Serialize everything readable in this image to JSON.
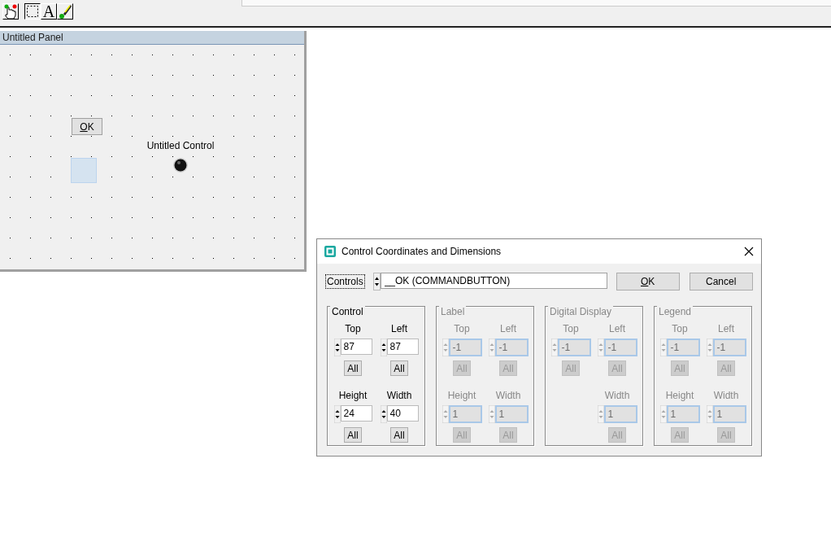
{
  "toolbar": {
    "tools": [
      {
        "kind": "hand",
        "selected": false
      },
      {
        "kind": "select",
        "selected": true
      },
      {
        "kind": "text",
        "glyph": "A",
        "selected": false
      },
      {
        "kind": "brush",
        "selected": false
      }
    ]
  },
  "panel": {
    "title": "Untitled Panel",
    "button": {
      "label": "OK",
      "underline_first": true
    },
    "control_label": "Untitled Control"
  },
  "dialog": {
    "title": "Control Coordinates and Dimensions",
    "controls_label": "Controls",
    "controls_value": "__OK (COMMANDBUTTON)",
    "buttons": [
      {
        "label": "OK",
        "underline_first": true
      },
      {
        "label": "Cancel",
        "underline_first": false
      }
    ],
    "groups": [
      {
        "title": "Control",
        "disabled": false,
        "fields": [
          {
            "kind": "spin",
            "label": "Top",
            "value": "87",
            "button": "All"
          },
          {
            "kind": "spin",
            "label": "Left",
            "value": "87",
            "button": "All"
          },
          {
            "kind": "spin",
            "label": "Height",
            "value": "24",
            "button": "All"
          },
          {
            "kind": "spin",
            "label": "Width",
            "value": "40",
            "button": "All"
          }
        ]
      },
      {
        "title": "Label",
        "disabled": true,
        "fields": [
          {
            "kind": "spin",
            "label": "Top",
            "value": "-1",
            "button": "All"
          },
          {
            "kind": "spin",
            "label": "Left",
            "value": "-1",
            "button": "All"
          },
          {
            "kind": "spin",
            "label": "Height",
            "value": "1",
            "button": "All"
          },
          {
            "kind": "spin",
            "label": "Width",
            "value": "1",
            "button": "All"
          }
        ]
      },
      {
        "title": "Digital Display",
        "disabled": true,
        "fields": [
          {
            "kind": "spin",
            "label": "Top",
            "value": "-1",
            "button": "All"
          },
          {
            "kind": "spin",
            "label": "Left",
            "value": "-1",
            "button": "All"
          },
          {
            "kind": "blank"
          },
          {
            "kind": "spin",
            "label": "Width",
            "value": "1",
            "button": "All"
          }
        ]
      },
      {
        "title": "Legend",
        "disabled": true,
        "fields": [
          {
            "kind": "spin",
            "label": "Top",
            "value": "-1",
            "button": "All"
          },
          {
            "kind": "spin",
            "label": "Left",
            "value": "-1",
            "button": "All"
          },
          {
            "kind": "spin",
            "label": "Height",
            "value": "1",
            "button": "All"
          },
          {
            "kind": "spin",
            "label": "Width",
            "value": "1",
            "button": "All"
          }
        ]
      }
    ]
  }
}
